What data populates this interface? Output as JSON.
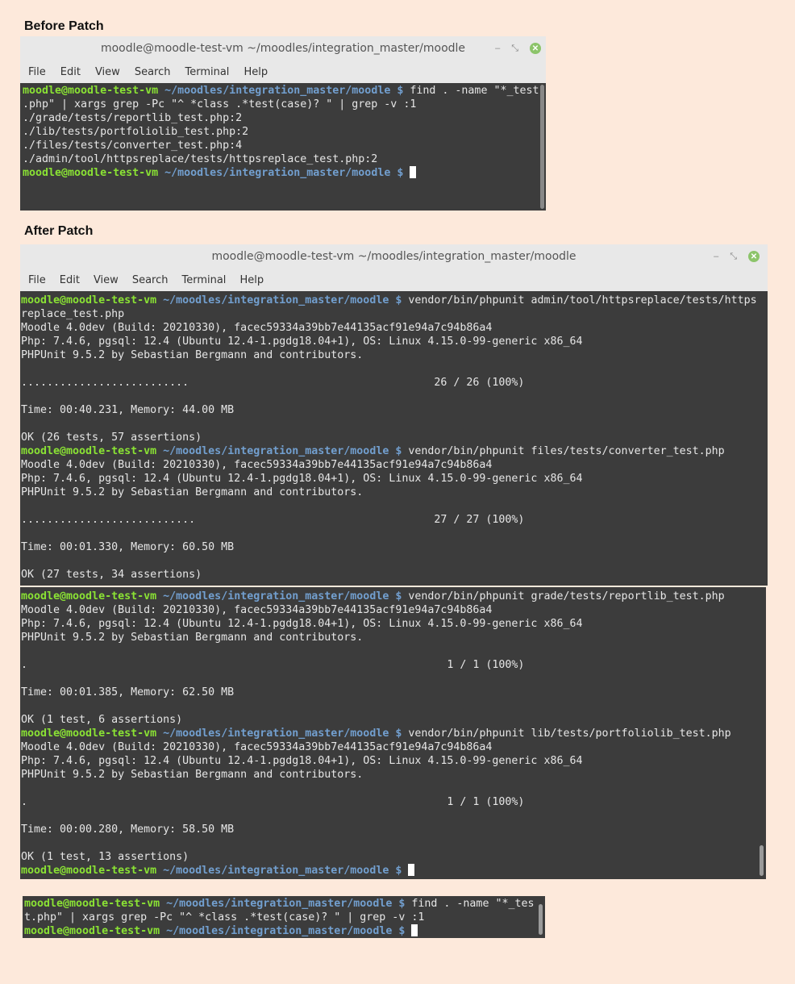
{
  "headings": {
    "before": "Before Patch",
    "after": "After Patch"
  },
  "window": {
    "title": "moodle@moodle-test-vm ~/moodles/integration_master/moodle",
    "menu": [
      "File",
      "Edit",
      "View",
      "Search",
      "Terminal",
      "Help"
    ],
    "controls": {
      "minimize": "–",
      "maximize": "⤡",
      "close": "✕"
    }
  },
  "prompt": {
    "user": "moodle@moodle-test-vm",
    "path": "~/moodles/integration_master/moodle",
    "symbol": "$"
  },
  "colors": {
    "background": "#fde9db",
    "terminal": "#3c3c3c",
    "user": "#8ae234",
    "path": "#729fcf",
    "close": "#8cc46a"
  },
  "before_terminal": [
    {
      "prompt": true,
      "text": " find . -name \"*_test"
    },
    {
      "text": ".php\" | xargs grep -Pc \"^ *class .*test(case)? \" | grep -v :1"
    },
    {
      "text": "./grade/tests/reportlib_test.php:2"
    },
    {
      "text": "./lib/tests/portfoliolib_test.php:2"
    },
    {
      "text": "./files/tests/converter_test.php:4"
    },
    {
      "text": "./admin/tool/httpsreplace/tests/httpsreplace_test.php:2"
    },
    {
      "prompt": true,
      "text": " ",
      "cursor": true
    }
  ],
  "after_terminal_1": [
    {
      "prompt": true,
      "text": " vendor/bin/phpunit admin/tool/httpsreplace/tests/https"
    },
    {
      "text": "replace_test.php"
    },
    {
      "text": "Moodle 4.0dev (Build: 20210330), facec59334a39bb7e44135acf91e94a7c94b86a4"
    },
    {
      "text": "Php: 7.4.6, pgsql: 12.4 (Ubuntu 12.4-1.pgdg18.04+1), OS: Linux 4.15.0-99-generic x86_64"
    },
    {
      "text": "PHPUnit 9.5.2 by Sebastian Bergmann and contributors."
    },
    {
      "text": ""
    },
    {
      "text": "..........................                                      26 / 26 (100%)"
    },
    {
      "text": ""
    },
    {
      "text": "Time: 00:40.231, Memory: 44.00 MB"
    },
    {
      "text": ""
    },
    {
      "text": "OK (26 tests, 57 assertions)"
    },
    {
      "prompt": true,
      "text": " vendor/bin/phpunit files/tests/converter_test.php"
    },
    {
      "text": "Moodle 4.0dev (Build: 20210330), facec59334a39bb7e44135acf91e94a7c94b86a4"
    },
    {
      "text": "Php: 7.4.6, pgsql: 12.4 (Ubuntu 12.4-1.pgdg18.04+1), OS: Linux 4.15.0-99-generic x86_64"
    },
    {
      "text": "PHPUnit 9.5.2 by Sebastian Bergmann and contributors."
    },
    {
      "text": ""
    },
    {
      "text": "...........................                                     27 / 27 (100%)"
    },
    {
      "text": ""
    },
    {
      "text": "Time: 00:01.330, Memory: 60.50 MB"
    },
    {
      "text": ""
    },
    {
      "text": "OK (27 tests, 34 assertions)"
    }
  ],
  "after_terminal_2": [
    {
      "prompt": true,
      "text": " vendor/bin/phpunit grade/tests/reportlib_test.php"
    },
    {
      "text": "Moodle 4.0dev (Build: 20210330), facec59334a39bb7e44135acf91e94a7c94b86a4"
    },
    {
      "text": "Php: 7.4.6, pgsql: 12.4 (Ubuntu 12.4-1.pgdg18.04+1), OS: Linux 4.15.0-99-generic x86_64"
    },
    {
      "text": "PHPUnit 9.5.2 by Sebastian Bergmann and contributors."
    },
    {
      "text": ""
    },
    {
      "text": ".                                                                 1 / 1 (100%)"
    },
    {
      "text": ""
    },
    {
      "text": "Time: 00:01.385, Memory: 62.50 MB"
    },
    {
      "text": ""
    },
    {
      "text": "OK (1 test, 6 assertions)"
    },
    {
      "prompt": true,
      "text": " vendor/bin/phpunit lib/tests/portfoliolib_test.php"
    },
    {
      "text": "Moodle 4.0dev (Build: 20210330), facec59334a39bb7e44135acf91e94a7c94b86a4"
    },
    {
      "text": "Php: 7.4.6, pgsql: 12.4 (Ubuntu 12.4-1.pgdg18.04+1), OS: Linux 4.15.0-99-generic x86_64"
    },
    {
      "text": "PHPUnit 9.5.2 by Sebastian Bergmann and contributors."
    },
    {
      "text": ""
    },
    {
      "text": ".                                                                 1 / 1 (100%)"
    },
    {
      "text": ""
    },
    {
      "text": "Time: 00:00.280, Memory: 58.50 MB"
    },
    {
      "text": ""
    },
    {
      "text": "OK (1 test, 13 assertions)"
    },
    {
      "prompt": true,
      "text": " ",
      "cursor": true
    }
  ],
  "after_terminal_3": [
    {
      "prompt": true,
      "text": " find . -name \"*_tes"
    },
    {
      "text": "t.php\" | xargs grep -Pc \"^ *class .*test(case)? \" | grep -v :1"
    },
    {
      "prompt": true,
      "text": " ",
      "cursor": true
    }
  ]
}
